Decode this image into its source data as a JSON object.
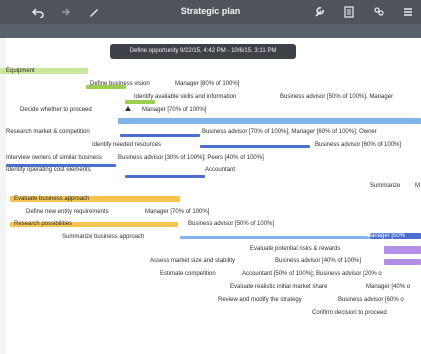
{
  "window": {
    "title": "Strategic plan"
  },
  "toolbar": {
    "left_icons": [
      "undo-icon",
      "redo-icon",
      "pencil-icon"
    ],
    "right_icons": [
      "wrench-icon",
      "document-icon",
      "people-icon",
      "list-icon"
    ]
  },
  "timeline": {
    "ticks": [
      "",
      "",
      "",
      "",
      "",
      "",
      ""
    ]
  },
  "tooltip": {
    "text": "Define opportunity  9/22/15, 4:42 PM - 10/6/15, 3:11 PM"
  },
  "tasks": [
    {
      "label": "Equipment",
      "assign": ""
    },
    {
      "label": "Define business vision",
      "assign": "Manager [80% of 100%]"
    },
    {
      "label": "Identify available skills and information",
      "assign": "Business advisor [50% of 100%], Manager"
    },
    {
      "label": "Decide whether to proceed",
      "assign": "Manager [70% of 100%]"
    },
    {
      "label": "Research market & competition",
      "assign": "Business advisor [70% of 100%]; Manager [60% of 100%]; Owner"
    },
    {
      "label": "Identify needed resources",
      "assign": "Business advisor [60% of 100%]"
    },
    {
      "label": "Interview owners of similar business",
      "assign": "Business advisor [30% of 100%]; Peers [40% of 100%]"
    },
    {
      "label": "Identify operating cost elements",
      "assign": "Accountant"
    },
    {
      "label": "Summarize",
      "assign": "M"
    },
    {
      "label": "Evaluate business approach",
      "assign": ""
    },
    {
      "label": "Define new entity requirements",
      "assign": "Manager [70% of 100%]"
    },
    {
      "label": "Research possibilities",
      "assign": "Business advisor [50% of 100%]"
    },
    {
      "label": "Summarize business approach",
      "assign": "Manager [50%"
    },
    {
      "label": "Evaluate potential risks & rewards",
      "assign": ""
    },
    {
      "label": "Assess market size and stability",
      "assign": "Business advisor [40% of 100%]"
    },
    {
      "label": "Estimate competition",
      "assign": "Accountant [50% of 100%]; Business advisor [20% o"
    },
    {
      "label": "Evaluate realistic initial market share",
      "assign": "Manager [40% o"
    },
    {
      "label": "Review and modify the strategy",
      "assign": "Business advisor [60% o"
    },
    {
      "label": "Confirm decision to proceed",
      "assign": ""
    }
  ]
}
